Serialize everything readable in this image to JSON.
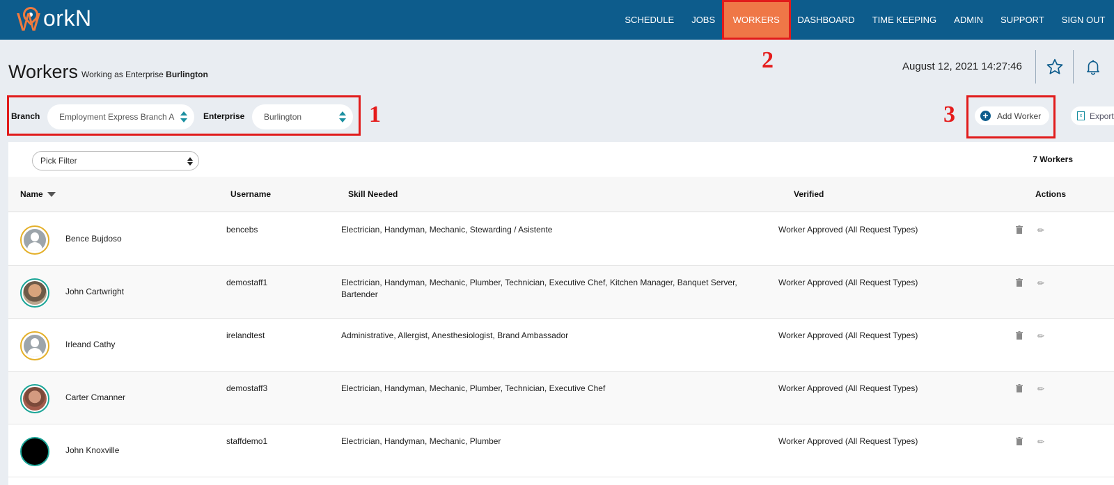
{
  "logo": {
    "text": "orkN",
    "letter": "W"
  },
  "nav": [
    "SCHEDULE",
    "JOBS",
    "WORKERS",
    "DASHBOARD",
    "TIME KEEPING",
    "ADMIN",
    "SUPPORT",
    "SIGN OUT"
  ],
  "nav_active": "WORKERS",
  "callouts": {
    "one": "1",
    "two": "2",
    "three": "3"
  },
  "header": {
    "title": "Workers",
    "working_prefix": "Working as Enterprise",
    "working_enterprise": "Burlington",
    "datetime": "August 12, 2021 14:27:46"
  },
  "filters": {
    "branch_label": "Branch",
    "branch_value": "Employment Express Branch A",
    "enterprise_label": "Enterprise",
    "enterprise_value": "Burlington"
  },
  "actions": {
    "add_worker": "Add Worker",
    "export": "Export"
  },
  "table": {
    "pick_filter": "Pick Filter",
    "count": "7 Workers",
    "headers": {
      "name": "Name",
      "username": "Username",
      "skill": "Skill Needed",
      "verified": "Verified",
      "actions": "Actions"
    },
    "rows": [
      {
        "name": "Bence Bujdoso",
        "username": "bencebs",
        "skills": "Electrician, Handyman, Mechanic, Stewarding / Asistente",
        "verified": "Worker Approved (All Request Types)",
        "avatar": "placeholder"
      },
      {
        "name": "John Cartwright",
        "username": "demostaff1",
        "skills": "Electrician, Handyman, Mechanic, Plumber, Technician, Executive Chef, Kitchen Manager, Banquet Server, Bartender",
        "verified": "Worker Approved (All Request Types)",
        "avatar": "photo"
      },
      {
        "name": "Irleand Cathy",
        "username": "irelandtest",
        "skills": "Administrative, Allergist, Anesthesiologist, Brand Ambassador",
        "verified": "Worker Approved (All Request Types)",
        "avatar": "placeholder"
      },
      {
        "name": "Carter Cmanner",
        "username": "demostaff3",
        "skills": "Electrician, Handyman, Mechanic, Plumber, Technician, Executive Chef",
        "verified": "Worker Approved (All Request Types)",
        "avatar": "photo"
      },
      {
        "name": "John Knoxville",
        "username": "staffdemo1",
        "skills": "Electrician, Handyman, Mechanic, Plumber",
        "verified": "Worker Approved (All Request Types)",
        "avatar": "black"
      }
    ]
  },
  "colors": {
    "nav_bg": "#0d5c8c",
    "accent": "#ef7747",
    "highlight": "#e11b1b",
    "teal": "#1a8fa0"
  }
}
